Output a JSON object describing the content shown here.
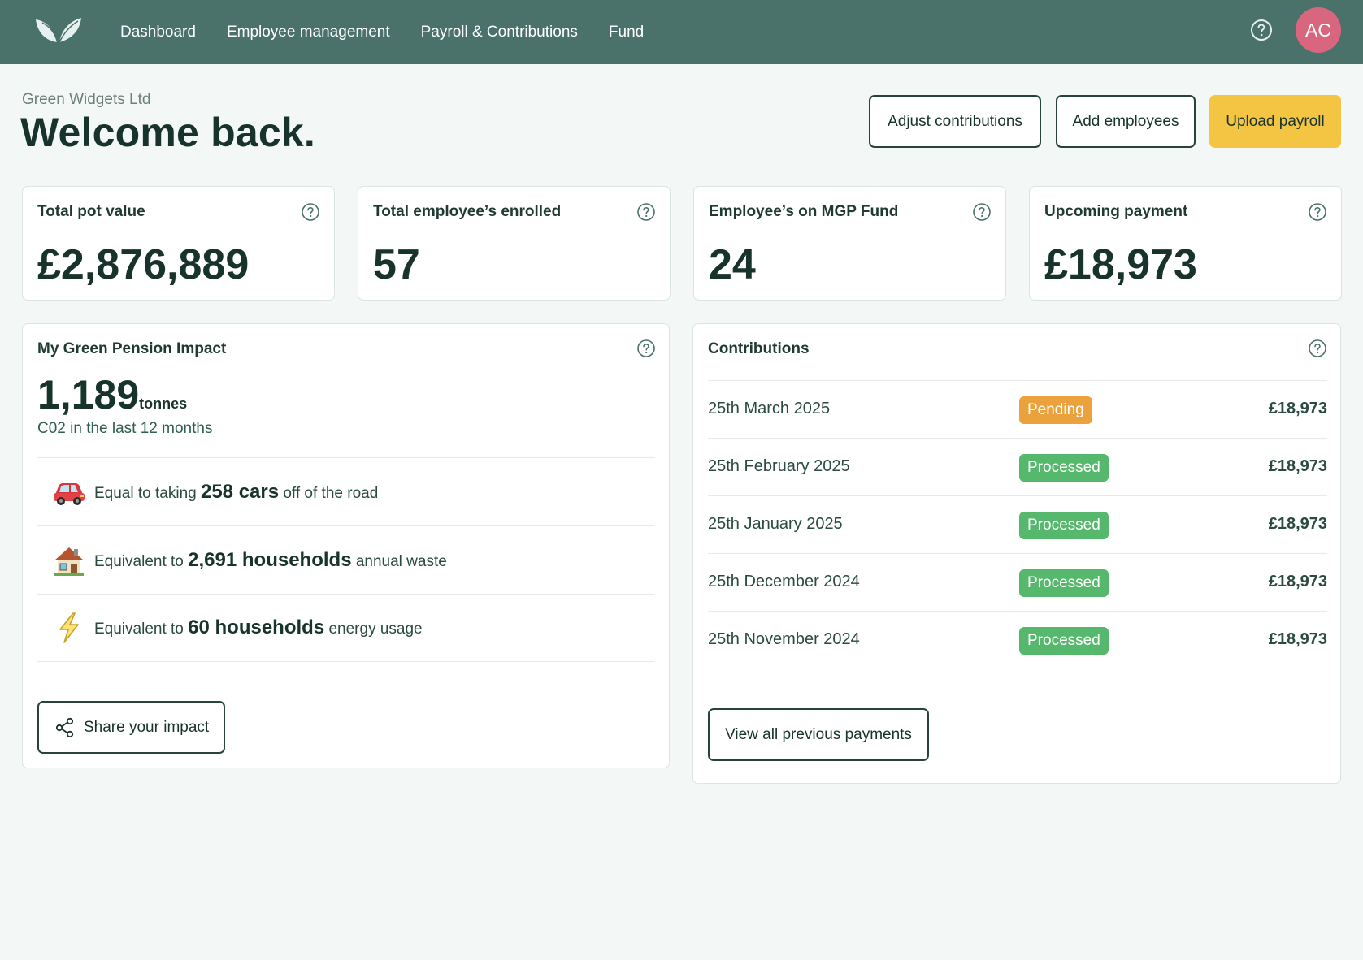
{
  "nav": {
    "items": [
      {
        "label": "Dashboard"
      },
      {
        "label": "Employee management"
      },
      {
        "label": "Payroll & Contributions"
      },
      {
        "label": "Fund"
      }
    ],
    "avatar_initials": "AC",
    "logo_icon": "leaf-logo-icon",
    "help_icon": "question-circle-icon"
  },
  "header": {
    "company": "Green Widgets Ltd",
    "welcome": "Welcome back.",
    "buttons": {
      "adjust": "Adjust contributions",
      "add": "Add employees",
      "upload": "Upload payroll"
    }
  },
  "stats": [
    {
      "title": "Total pot value",
      "value": "£2,876,889"
    },
    {
      "title": "Total employee’s enrolled",
      "value": "57"
    },
    {
      "title": "Employee’s on MGP Fund",
      "value": "24"
    },
    {
      "title": "Upcoming payment",
      "value": "£18,973"
    }
  ],
  "impact": {
    "title": "My Green Pension Impact",
    "value": "1,189",
    "unit": "tonnes",
    "subtitle": "C02 in the last 12 months",
    "rows": [
      {
        "icon": "car-icon",
        "prefix": "Equal to taking",
        "highlight": "258 cars",
        "suffix": "off of the road"
      },
      {
        "icon": "house-icon",
        "prefix": "Equivalent to",
        "highlight": "2,691 households",
        "suffix": "annual waste"
      },
      {
        "icon": "lightning-icon",
        "prefix": "Equivalent to",
        "highlight": "60 households",
        "suffix": "energy usage"
      }
    ],
    "share_label": "Share your impact"
  },
  "contributions": {
    "title": "Contributions",
    "rows": [
      {
        "date": "25th March 2025",
        "status": "Pending",
        "amount": "£18,973"
      },
      {
        "date": "25th February 2025",
        "status": "Processed",
        "amount": "£18,973"
      },
      {
        "date": "25th January 2025",
        "status": "Processed",
        "amount": "£18,973"
      },
      {
        "date": "25th December 2024",
        "status": "Processed",
        "amount": "£18,973"
      },
      {
        "date": "25th November 2024",
        "status": "Processed",
        "amount": "£18,973"
      }
    ],
    "view_all_label": "View all previous payments"
  },
  "colors": {
    "nav_bg": "#4a716a",
    "accent_yellow": "#f4c542",
    "avatar": "#d9667f",
    "pending": "#eba23d",
    "processed": "#55b86c"
  }
}
